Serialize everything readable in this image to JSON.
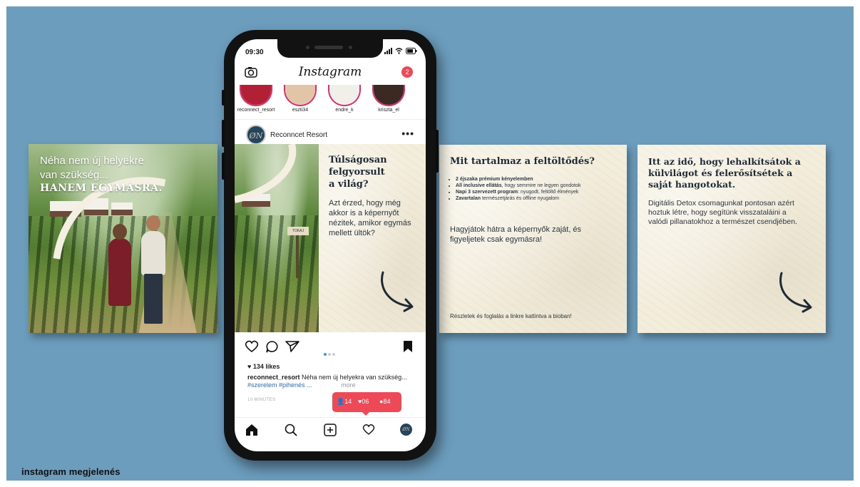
{
  "footer_label": "instagram megjelenés",
  "colors": {
    "background": "#6c9dbd",
    "cream": "#f3eddc",
    "navy": "#1d2a35",
    "brand_red": "#ed4956",
    "link_blue": "#2f6db0"
  },
  "slide1": {
    "line1": "Néha nem új helyekre",
    "line2": "van szükség...",
    "line3": "HANEM EGYMÁSRA."
  },
  "phone": {
    "status_time": "09:30",
    "status_icons": "signal-icon wifi-icon battery-icon",
    "app_logo": "Instagram",
    "notification_count": "2",
    "stories": [
      {
        "name": "reconnect_resort"
      },
      {
        "name": "eszti34"
      },
      {
        "name": "endre_k"
      },
      {
        "name": "kriszta_el"
      }
    ],
    "post": {
      "avatar_text": "ØN",
      "username": "Reconncet Resort",
      "more": "•••",
      "sign_text": "TOKAJ",
      "title_lines": [
        "Túlságosan",
        "felgyorsult",
        "a világ?"
      ],
      "body": "Azt érzed, hogy még akkor is a képernyőt nézitek, amikor egymás mellett ültök?",
      "likes": "134 likes",
      "caption_user": "reconnect_resort",
      "caption_text": " Néha nem új helyekra van szükség...",
      "caption_tags": "#szerelem #pihenés ...",
      "caption_more": "more",
      "time_ago": "10 MINUTES"
    },
    "notifications": {
      "followers": "14",
      "likes": "06",
      "comments": "84"
    }
  },
  "slide3": {
    "title": "Mit tartalmaz a feltöltődés?",
    "bullets": [
      {
        "bold": "2 éjszaka prémium kényelemben",
        "rest": ""
      },
      {
        "bold": "All inclusive ellátás",
        "rest": ", hogy semmire ne legyen gondotok"
      },
      {
        "bold": "Napi 3 szervezett program",
        "rest": ": nyugodt, feltöltő élmények"
      },
      {
        "bold": "Zavartalan",
        "rest": " természetjárás és offline nyugalom"
      }
    ],
    "middle": "Hagyjátok hátra a képernyők zaját, és figyeljetek csak egymásra!",
    "bottom": "Részletek és foglalás a linkre kattintva a bioban!"
  },
  "slide4": {
    "title": "Itt az idő, hogy lehalkítsátok a külvilágot és felerősítsétek a saját hangotokat.",
    "body": "Digitális Detox csomagunkat pontosan azért hoztuk létre, hogy segítünk visszataláini a valódi pillanatokhoz a természet csendjében."
  }
}
